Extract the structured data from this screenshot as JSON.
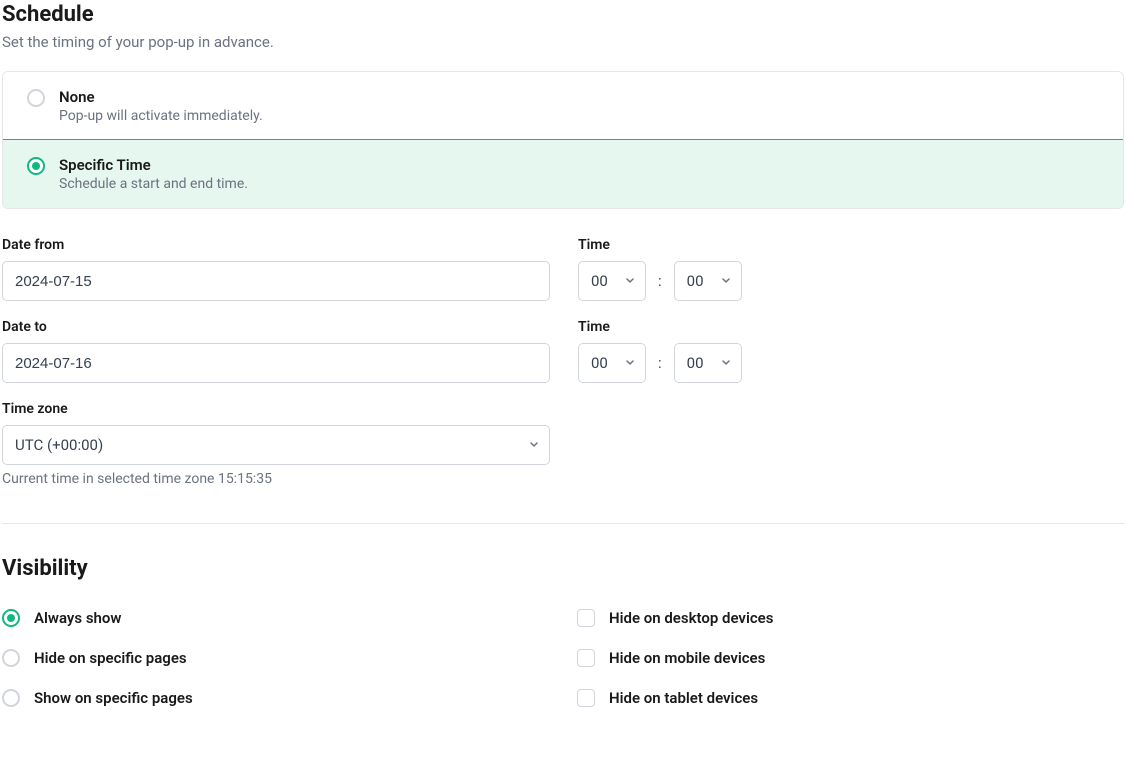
{
  "schedule": {
    "title": "Schedule",
    "description": "Set the timing of your pop-up in advance.",
    "options": {
      "none": {
        "title": "None",
        "sub": "Pop-up will activate immediately."
      },
      "specific": {
        "title": "Specific Time",
        "sub": "Schedule a start and end time."
      }
    },
    "dateFrom": {
      "label": "Date from",
      "value": "2024-07-15"
    },
    "dateTo": {
      "label": "Date to",
      "value": "2024-07-16"
    },
    "timeLabel": "Time",
    "timeFrom": {
      "hour": "00",
      "minute": "00"
    },
    "timeTo": {
      "hour": "00",
      "minute": "00"
    },
    "timezone": {
      "label": "Time zone",
      "value": "UTC (+00:00)"
    },
    "currentTime": "Current time in selected time zone 15:15:35"
  },
  "visibility": {
    "title": "Visibility",
    "radios": {
      "always": "Always show",
      "hidePages": "Hide on specific pages",
      "showPages": "Show on specific pages"
    },
    "checks": {
      "desktop": "Hide on desktop devices",
      "mobile": "Hide on mobile devices",
      "tablet": "Hide on tablet devices"
    }
  }
}
